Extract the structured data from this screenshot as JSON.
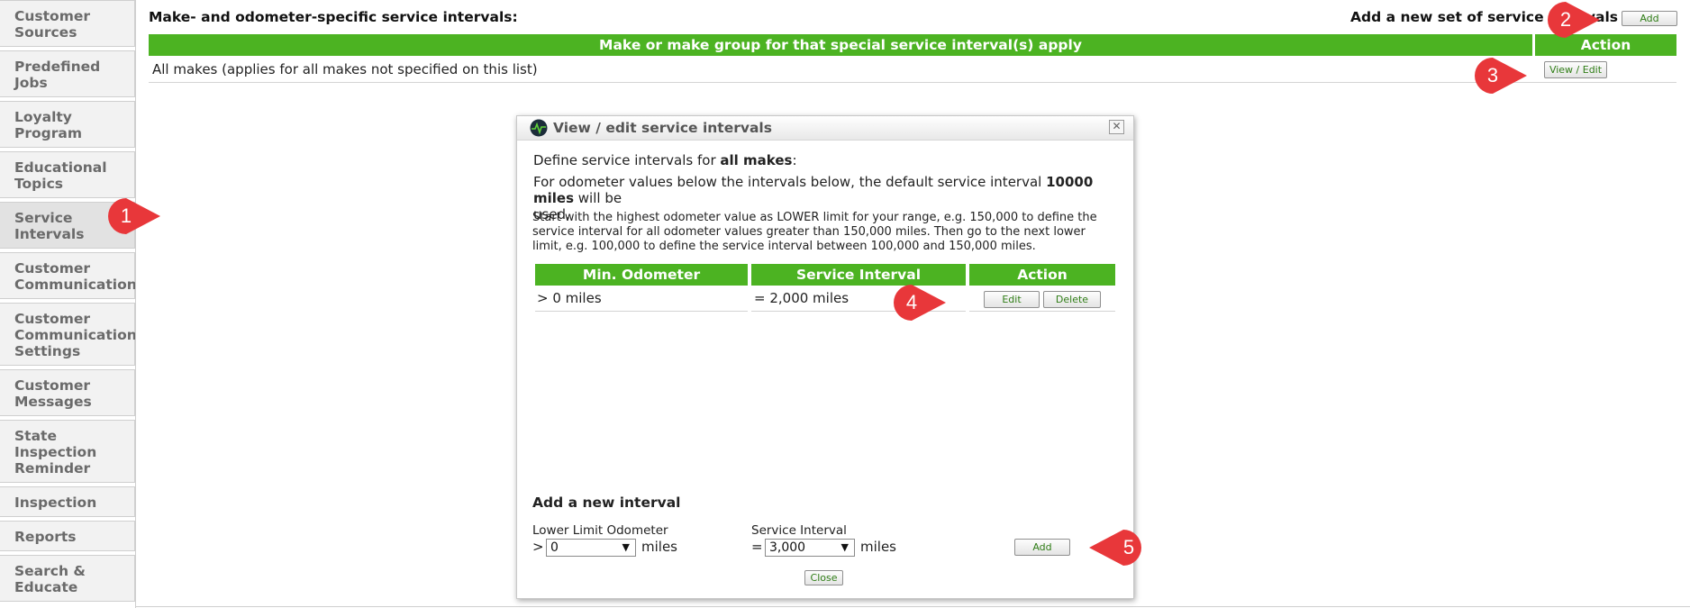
{
  "sidebar": {
    "items": [
      {
        "label": "Customer\nSources"
      },
      {
        "label": "Predefined\nJobs"
      },
      {
        "label": "Loyalty\nProgram"
      },
      {
        "label": "Educational\nTopics"
      },
      {
        "label": "Service\nIntervals"
      },
      {
        "label": "Customer\nCommunication"
      },
      {
        "label": "Customer\nCommunication\nSettings"
      },
      {
        "label": "Customer\nMessages"
      },
      {
        "label": "State\nInspection\nReminder"
      },
      {
        "label": "Inspection"
      },
      {
        "label": "Reports"
      },
      {
        "label": "Search &\nEducate"
      }
    ],
    "active_index": 4
  },
  "main": {
    "section_title": "Make- and odometer-specific service intervals:",
    "add_set_label": "Add a new set of service intervals",
    "add_set_button": "Add",
    "table": {
      "headers": [
        "Make or make group for that special service interval(s) apply",
        "Action"
      ],
      "rows": [
        {
          "make": "All makes (applies for all makes not specified on this list)",
          "action": "View / Edit"
        }
      ]
    }
  },
  "dialog": {
    "title": "View / edit service intervals",
    "close_glyph": "✕",
    "define_prefix": "Define service intervals for ",
    "define_bold": "all makes",
    "define_suffix": ":",
    "default_line_1": "For odometer values below the intervals below, the default service interval ",
    "default_bold": "10000 miles",
    "default_line_2": " will be",
    "default_line_3": "used.",
    "instructions": "Start with the highest odometer value as LOWER limit for your range, e.g. 150,000 to define the service interval for all odometer values greater than 150,000 miles. Then go to the next lower limit, e.g. 100,000 to define the service interval between 100,000 and 150,000 miles.",
    "table": {
      "headers": [
        "Min. Odometer",
        "Service Interval",
        "Action"
      ],
      "rows": [
        {
          "min": "> 0 miles",
          "interval": "= 2,000 miles",
          "edit": "Edit",
          "delete": "Delete"
        }
      ]
    },
    "add_section_title": "Add a new interval",
    "lower_limit_label": "Lower Limit Odometer",
    "lower_prefix": ">",
    "lower_value": "0",
    "lower_unit": "miles",
    "interval_label": "Service Interval",
    "interval_prefix": "=",
    "interval_value": "3,000",
    "interval_unit": "miles",
    "add_button": "Add",
    "close_button": "Close"
  },
  "callouts": [
    "1",
    "2",
    "3",
    "4",
    "5"
  ],
  "colors": {
    "accent": "#4cb322",
    "callout": "#e8373a",
    "button_text": "#2f7d16"
  }
}
